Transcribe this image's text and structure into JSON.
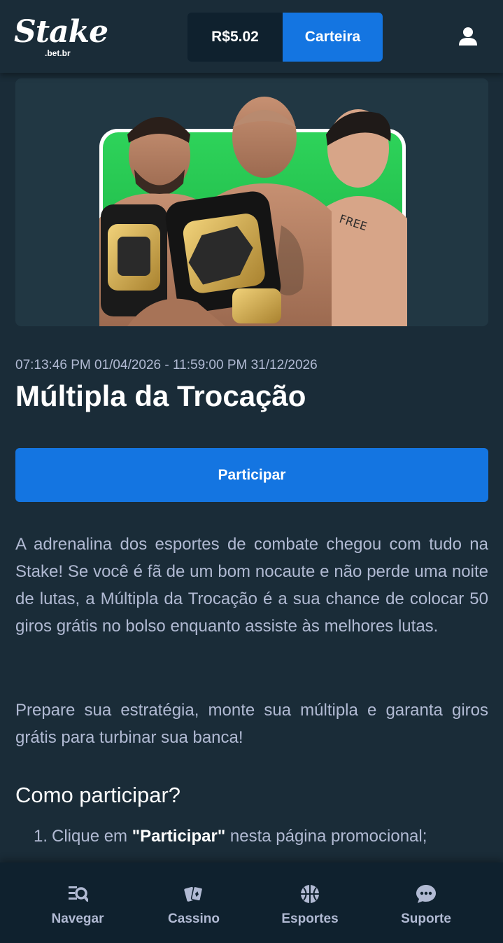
{
  "header": {
    "logo_text": "Stake",
    "logo_sub": ".bet.br",
    "balance": "R$5.02",
    "wallet_label": "Carteira",
    "user_icon": "user-icon"
  },
  "banner": {
    "image": "UFC fighters with championship belts on green background"
  },
  "promo": {
    "date_range": "07:13:46 PM 01/04/2026 - 11:59:00 PM 31/12/2026",
    "title": "Múltipla da Trocação",
    "join_label": "Participar",
    "paragraph1": "A adrenalina dos esportes de combate chegou com tudo na Stake! Se você é fã de um bom nocaute e não perde uma noite de lutas, a Múltipla da Trocação é a sua chance de colocar 50 giros grátis no bolso enquanto assiste às melhores lutas.",
    "paragraph2": "Prepare sua estratégia, monte sua múltipla e garanta giros grátis para turbinar sua banca!",
    "how_title": "Como participar?",
    "step1_num": "1.",
    "step1_pre": "Clique em ",
    "step1_bold": "\"Participar\"",
    "step1_post": " nesta página promocional;"
  },
  "nav": {
    "items": [
      {
        "label": "Navegar",
        "icon": "browse-icon"
      },
      {
        "label": "Cassino",
        "icon": "cards-icon"
      },
      {
        "label": "Esportes",
        "icon": "basketball-icon"
      },
      {
        "label": "Suporte",
        "icon": "chat-icon"
      }
    ]
  },
  "colors": {
    "background": "#1a2c38",
    "header_dark": "#0f212e",
    "accent_blue": "#1475e1",
    "text_muted": "#b1bad3",
    "banner_green": "#1fbf4a"
  }
}
